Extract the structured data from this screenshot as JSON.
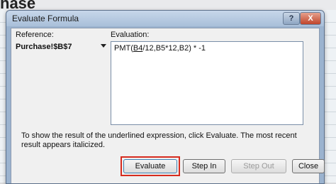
{
  "backdrop": {
    "title_fragment": "hase"
  },
  "dialog": {
    "title": "Evaluate Formula",
    "help_glyph": "?",
    "close_glyph": "X"
  },
  "reference": {
    "label": "Reference:",
    "value": "Purchase!$B$7"
  },
  "evaluation": {
    "label": "Evaluation:",
    "prefix": "PMT(",
    "underlined": "B4",
    "suffix": "/12,B5*12,B2) * -1"
  },
  "description": "To show the result of the underlined expression, click Evaluate.  The most recent result appears italicized.",
  "buttons": {
    "evaluate": "Evaluate",
    "step_in": "Step In",
    "step_out": "Step Out",
    "close": "Close"
  },
  "colors": {
    "focus_highlight": "#d62b1e",
    "title_bar": "#a9bfd9"
  }
}
